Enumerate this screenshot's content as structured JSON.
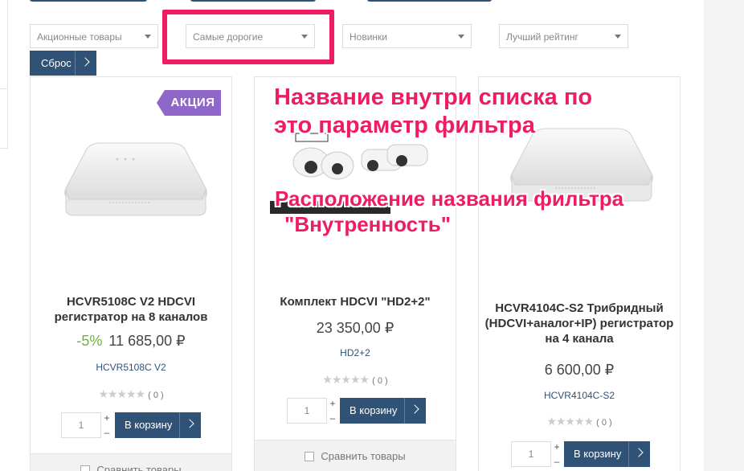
{
  "filters": [
    {
      "value": "Акционные товары"
    },
    {
      "value": "Самые дорогие"
    },
    {
      "value": "Новинки"
    },
    {
      "value": "Лучший рейтинг"
    }
  ],
  "reset_label": "Сброс",
  "products": [
    {
      "badge": "АКЦИЯ",
      "title": "HCVR5108C V2 HDCVI регистратор на 8 каналов",
      "discount": "-5%",
      "price": "11 685,00 ₽",
      "sku": "HCVR5108C V2",
      "rating_count": "( 0 )",
      "qty": "1",
      "cart_label": "В корзину",
      "compare_label": "Сравнить товары"
    },
    {
      "title": "Комплект HDCVI \"HD2+2\"",
      "price": "23 350,00 ₽",
      "sku": "HD2+2",
      "rating_count": "( 0 )",
      "qty": "1",
      "cart_label": "В корзину",
      "compare_label": "Сравнить товары"
    },
    {
      "title": "HCVR4104C-S2 Трибридный (HDCVI+аналог+IP) регистратор на 4 канала",
      "price": "6 600,00 ₽",
      "sku": "HCVR4104C-S2",
      "rating_count": "( 0 )",
      "qty": "1",
      "cart_label": "В корзину"
    }
  ],
  "annotations": {
    "line1": "Название внутри списка по",
    "line2": "это параметр фильтра",
    "line3": "Расположение названия фильтра",
    "line4": "\"Внутренность\""
  },
  "colors": {
    "accent": "#2f5276",
    "highlight": "#ee1d62",
    "badge": "#8e67c8",
    "discount": "#6fb13c"
  }
}
